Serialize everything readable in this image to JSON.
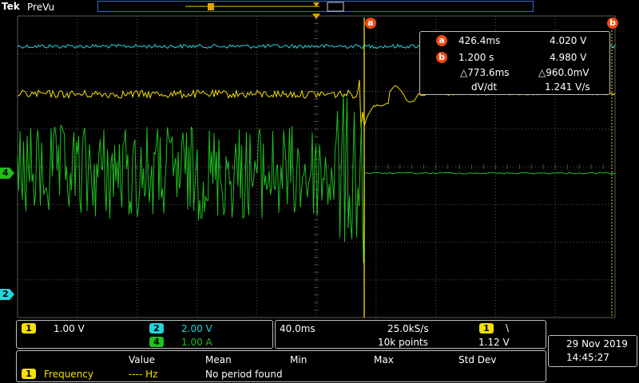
{
  "header": {
    "brand": "Tek",
    "mode": "PreVu"
  },
  "cursors": {
    "a_label": "a",
    "b_label": "b",
    "a_time": "426.4ms",
    "a_volt": "4.020 V",
    "b_time": "1.200 s",
    "b_volt": "4.980 V",
    "delta_time": "△773.6ms",
    "delta_volt": "△960.0mV",
    "dvdt_label": "dV/dt",
    "dvdt_value": "1.241 V/s"
  },
  "markers": {
    "ch4": "4",
    "ch2": "2",
    "trigger_pos": "T"
  },
  "channels": {
    "ch1": {
      "num": "1",
      "scale": "1.00 V"
    },
    "ch2": {
      "num": "2",
      "scale": "2.00 V"
    },
    "ch4": {
      "num": "4",
      "scale": "1.00 A"
    }
  },
  "horizontal": {
    "timebase": "40.0ms",
    "sample_rate": "25.0kS/s",
    "record_length": "10k points"
  },
  "trigger": {
    "source": "1",
    "slope": "\\",
    "level": "1.12 V"
  },
  "datetime": {
    "date": "29 Nov 2019",
    "time": "14:45:27"
  },
  "measurements": {
    "headers": [
      "Value",
      "Mean",
      "Min",
      "Max",
      "Std Dev"
    ],
    "row": {
      "channel": "1",
      "name": "Frequency",
      "value": "---- Hz",
      "mean": "No period found"
    }
  },
  "colors": {
    "ch1": "#f5e000",
    "ch2": "#24d3dc",
    "ch4": "#1fbf1f",
    "cursor": "#f04a10",
    "grid": "#555555"
  }
}
